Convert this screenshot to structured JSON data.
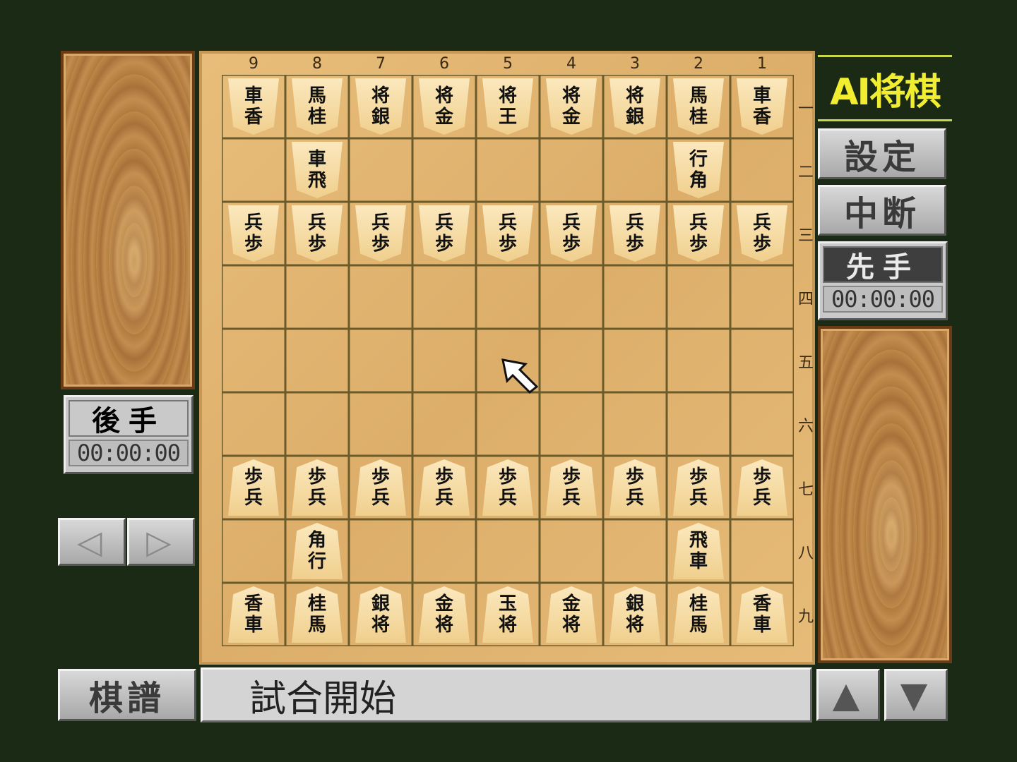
{
  "title": "AI将棋",
  "menu": {
    "settings": "設定",
    "pause": "中断",
    "kifu": "棋譜"
  },
  "sente": {
    "label": "先手",
    "time": "00:00:00"
  },
  "gote": {
    "label": "後手",
    "time": "00:00:00"
  },
  "nav": {
    "prev": "◁",
    "next": "▷",
    "up": "▲",
    "down": "▼"
  },
  "status": "試合開始",
  "board": {
    "files": [
      "9",
      "8",
      "7",
      "6",
      "5",
      "4",
      "3",
      "2",
      "1"
    ],
    "ranks": [
      "一",
      "二",
      "三",
      "四",
      "五",
      "六",
      "七",
      "八",
      "九"
    ],
    "rows": [
      [
        [
          "gote",
          "香車"
        ],
        [
          "gote",
          "桂馬"
        ],
        [
          "gote",
          "銀将"
        ],
        [
          "gote",
          "金将"
        ],
        [
          "gote",
          "王将"
        ],
        [
          "gote",
          "金将"
        ],
        [
          "gote",
          "銀将"
        ],
        [
          "gote",
          "桂馬"
        ],
        [
          "gote",
          "香車"
        ]
      ],
      [
        null,
        [
          "gote",
          "飛車"
        ],
        null,
        null,
        null,
        null,
        null,
        [
          "gote",
          "角行"
        ],
        null
      ],
      [
        [
          "gote",
          "歩兵"
        ],
        [
          "gote",
          "歩兵"
        ],
        [
          "gote",
          "歩兵"
        ],
        [
          "gote",
          "歩兵"
        ],
        [
          "gote",
          "歩兵"
        ],
        [
          "gote",
          "歩兵"
        ],
        [
          "gote",
          "歩兵"
        ],
        [
          "gote",
          "歩兵"
        ],
        [
          "gote",
          "歩兵"
        ]
      ],
      [
        null,
        null,
        null,
        null,
        null,
        null,
        null,
        null,
        null
      ],
      [
        null,
        null,
        null,
        null,
        null,
        null,
        null,
        null,
        null
      ],
      [
        null,
        null,
        null,
        null,
        null,
        null,
        null,
        null,
        null
      ],
      [
        [
          "sente",
          "歩兵"
        ],
        [
          "sente",
          "歩兵"
        ],
        [
          "sente",
          "歩兵"
        ],
        [
          "sente",
          "歩兵"
        ],
        [
          "sente",
          "歩兵"
        ],
        [
          "sente",
          "歩兵"
        ],
        [
          "sente",
          "歩兵"
        ],
        [
          "sente",
          "歩兵"
        ],
        [
          "sente",
          "歩兵"
        ]
      ],
      [
        null,
        [
          "sente",
          "角行"
        ],
        null,
        null,
        null,
        null,
        null,
        [
          "sente",
          "飛車"
        ],
        null
      ],
      [
        [
          "sente",
          "香車"
        ],
        [
          "sente",
          "桂馬"
        ],
        [
          "sente",
          "銀将"
        ],
        [
          "sente",
          "金将"
        ],
        [
          "sente",
          "玉将"
        ],
        [
          "sente",
          "金将"
        ],
        [
          "sente",
          "銀将"
        ],
        [
          "sente",
          "桂馬"
        ],
        [
          "sente",
          "香車"
        ]
      ]
    ]
  },
  "colors": {
    "background": "#1b2a14",
    "title": "#f1ee32"
  }
}
